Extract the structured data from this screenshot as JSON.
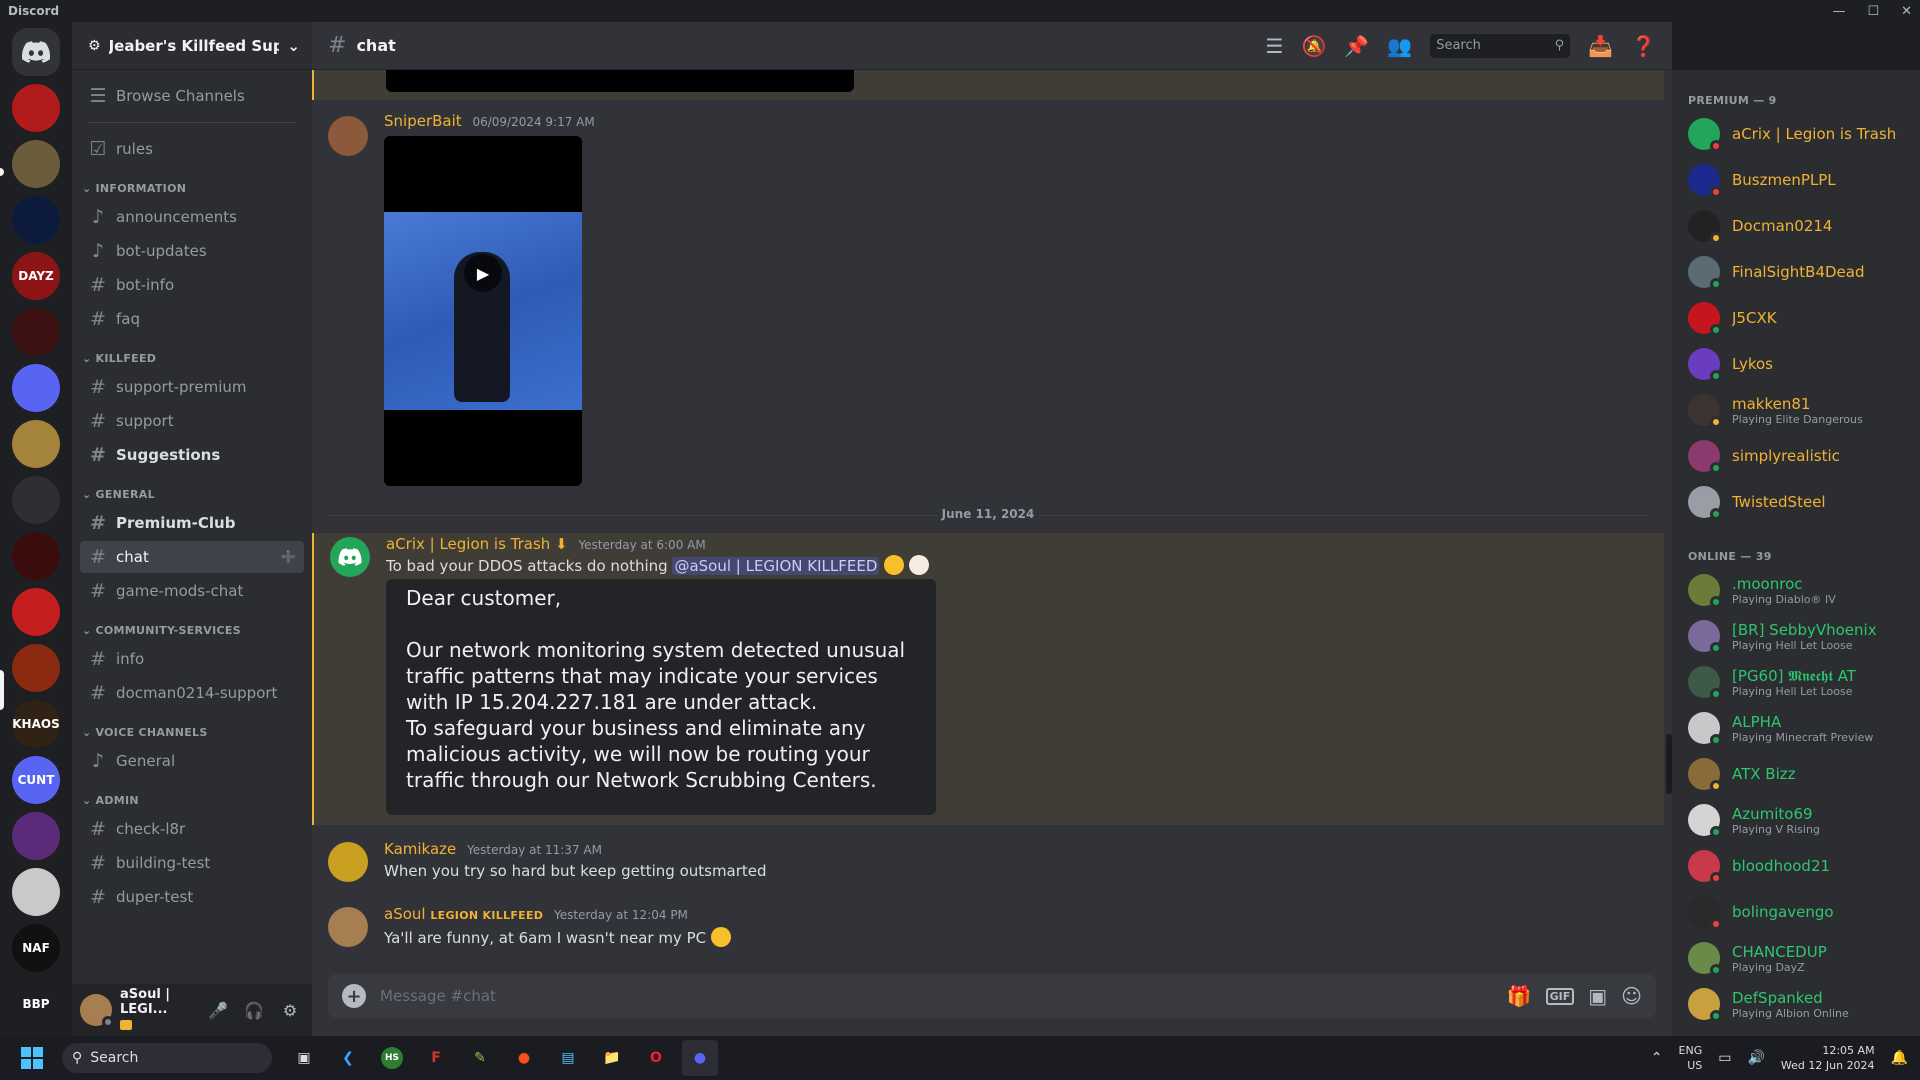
{
  "window": {
    "app_title": "Discord"
  },
  "guild": {
    "name": "Jeaber's Killfeed Sup..."
  },
  "sidebar": {
    "browse": "Browse Channels",
    "rules": "rules",
    "categories": [
      {
        "name": "INFORMATION",
        "channels": [
          "announcements",
          "bot-updates",
          "bot-info",
          "faq"
        ]
      },
      {
        "name": "KILLFEED",
        "channels": [
          "support-premium",
          "support",
          "Suggestions"
        ]
      },
      {
        "name": "GENERAL",
        "channels": [
          "Premium-Club",
          "chat",
          "game-mods-chat"
        ]
      },
      {
        "name": "COMMUNITY-SERVICES",
        "channels": [
          "info",
          "docman0214-support"
        ]
      },
      {
        "name": "VOICE CHANNELS",
        "channels": [
          "General"
        ]
      },
      {
        "name": "ADMIN",
        "channels": [
          "check-l8r",
          "building-test",
          "duper-test"
        ]
      }
    ],
    "user": {
      "name": "aSoul | LEGI..."
    }
  },
  "servers": {
    "items": [
      {
        "label": "",
        "color": "#5865f2"
      },
      {
        "label": "",
        "color": "#b11b1b"
      },
      {
        "label": "",
        "color": "#6b5d3b"
      },
      {
        "label": "",
        "color": "#0c1a3c"
      },
      {
        "label": "DAYZ",
        "color": "#8e1515"
      },
      {
        "label": "",
        "color": "#3d1212"
      },
      {
        "label": "",
        "color": "#5865f2"
      },
      {
        "label": "",
        "color": "#a3843a"
      },
      {
        "label": "",
        "color": "#2e2f35"
      },
      {
        "label": "",
        "color": "#3a0c0c"
      },
      {
        "label": "",
        "color": "#c41e1e"
      },
      {
        "label": "",
        "color": "#8a2a10"
      },
      {
        "label": "KHAOS",
        "color": "#302214"
      },
      {
        "label": "CUNT",
        "color": "#5865f2"
      },
      {
        "label": "",
        "color": "#5b2b7a"
      },
      {
        "label": "",
        "color": "#c9c9c9"
      },
      {
        "label": "NAF",
        "color": "#111111"
      },
      {
        "label": "BBP",
        "color": "#1e1f22"
      }
    ]
  },
  "header": {
    "channel": "chat",
    "search_placeholder": "Search"
  },
  "messages": {
    "m1": {
      "author": "SniperBait",
      "time": "06/09/2024 9:17 AM"
    },
    "date_divider": "June 11, 2024",
    "m2": {
      "author": "aCrix | Legion is Trash ⬇",
      "time": "Yesterday at 6:00 AM",
      "text": "To bad your DDOS attacks do nothing",
      "mention": "@aSoul | LEGION KILLFEED",
      "image_text": "Dear customer,\n\nOur network monitoring system detected unusual\ntraffic patterns that may indicate your services\nwith IP 15.204.227.181 are under attack.\nTo safeguard your business and eliminate any\nmalicious activity, we will now be routing your\ntraffic through our Network Scrubbing Centers."
    },
    "m3": {
      "author": "Kamikaze",
      "time": "Yesterday at 11:37 AM",
      "text": "When you try so hard but keep getting outsmarted"
    },
    "m4": {
      "author": "aSoul",
      "role_tag": "LEGION KILLFEED",
      "time": "Yesterday at 12:04 PM",
      "text": "Ya'll are funny, at 6am I wasn't near my PC"
    }
  },
  "composer": {
    "placeholder": "Message #chat"
  },
  "members": {
    "premium_header": "PREMIUM — 9",
    "online_header": "ONLINE — 39",
    "premium": [
      {
        "name": "aCrix | Legion is Trash ⬇",
        "activity": "",
        "color": "#f0b232",
        "av": "#23a55a",
        "status": "#f23f43"
      },
      {
        "name": "BuszmenPLPL",
        "activity": "",
        "color": "#f0b232",
        "av": "#1b2a8c",
        "status": "#f23f43"
      },
      {
        "name": "Docman0214",
        "activity": "",
        "color": "#f0b232",
        "av": "#222222",
        "status": "#f0b232"
      },
      {
        "name": "FinalSightB4Dead",
        "activity": "",
        "color": "#f0b232",
        "av": "#5a6b72",
        "status": "#23a55a"
      },
      {
        "name": "J5CXK",
        "activity": "",
        "color": "#f0b232",
        "av": "#c4161c",
        "status": "#23a55a"
      },
      {
        "name": "Lykos",
        "activity": "",
        "color": "#f0b232",
        "av": "#6a3cc0",
        "status": "#23a55a"
      },
      {
        "name": "makken81",
        "activity": "Playing Elite Dangerous",
        "color": "#f0b232",
        "av": "#3b3430",
        "status": "#f0b232"
      },
      {
        "name": "simplyrealistic",
        "activity": "",
        "color": "#f0b232",
        "av": "#8a3a6c",
        "status": "#23a55a"
      },
      {
        "name": "TwistedSteel",
        "activity": "",
        "color": "#f0b232",
        "av": "#9a9da6",
        "status": "#23a55a"
      }
    ],
    "online": [
      {
        "name": ".moonroc",
        "activity": "Playing Diablo® IV",
        "color": "#2dc770",
        "av": "#6b7b3a",
        "status": "#23a55a"
      },
      {
        "name": "[BR] SebbyVhoenix",
        "activity": "Playing Hell Let Loose",
        "color": "#2dc770",
        "av": "#7a6a9a",
        "status": "#23a55a"
      },
      {
        "name": "[PG60] 𝕸𝖓𝖊𝖈𝖍𝖙 AT",
        "activity": "Playing Hell Let Loose",
        "color": "#2dc770",
        "av": "#3c5a46",
        "status": "#23a55a"
      },
      {
        "name": "ALPHA",
        "activity": "Playing Minecraft Preview",
        "color": "#2dc770",
        "av": "#c8c8c8",
        "status": "#23a55a"
      },
      {
        "name": "ATX Bizz",
        "activity": "",
        "color": "#2dc770",
        "av": "#8a6a3a",
        "status": "#f0b232"
      },
      {
        "name": "Azumito69",
        "activity": "Playing V Rising",
        "color": "#2dc770",
        "av": "#d4d4d4",
        "status": "#23a55a"
      },
      {
        "name": "bloodhood21",
        "activity": "",
        "color": "#2dc770",
        "av": "#c83a4a",
        "status": "#f23f43"
      },
      {
        "name": "bolingavengo",
        "activity": "",
        "color": "#2dc770",
        "av": "#2a2a2a",
        "status": "#f23f43"
      },
      {
        "name": "CHANCEDUP",
        "activity": "Playing DayZ",
        "color": "#2dc770",
        "av": "#6a8a4a",
        "status": "#23a55a"
      },
      {
        "name": "DefSpanked",
        "activity": "Playing Albion Online",
        "color": "#2dc770",
        "av": "#c8a040",
        "status": "#23a55a"
      }
    ]
  },
  "taskbar": {
    "search": "Search",
    "lang1": "ENG",
    "lang2": "US",
    "time": "12:05 AM",
    "date": "Wed 12 Jun 2024"
  }
}
